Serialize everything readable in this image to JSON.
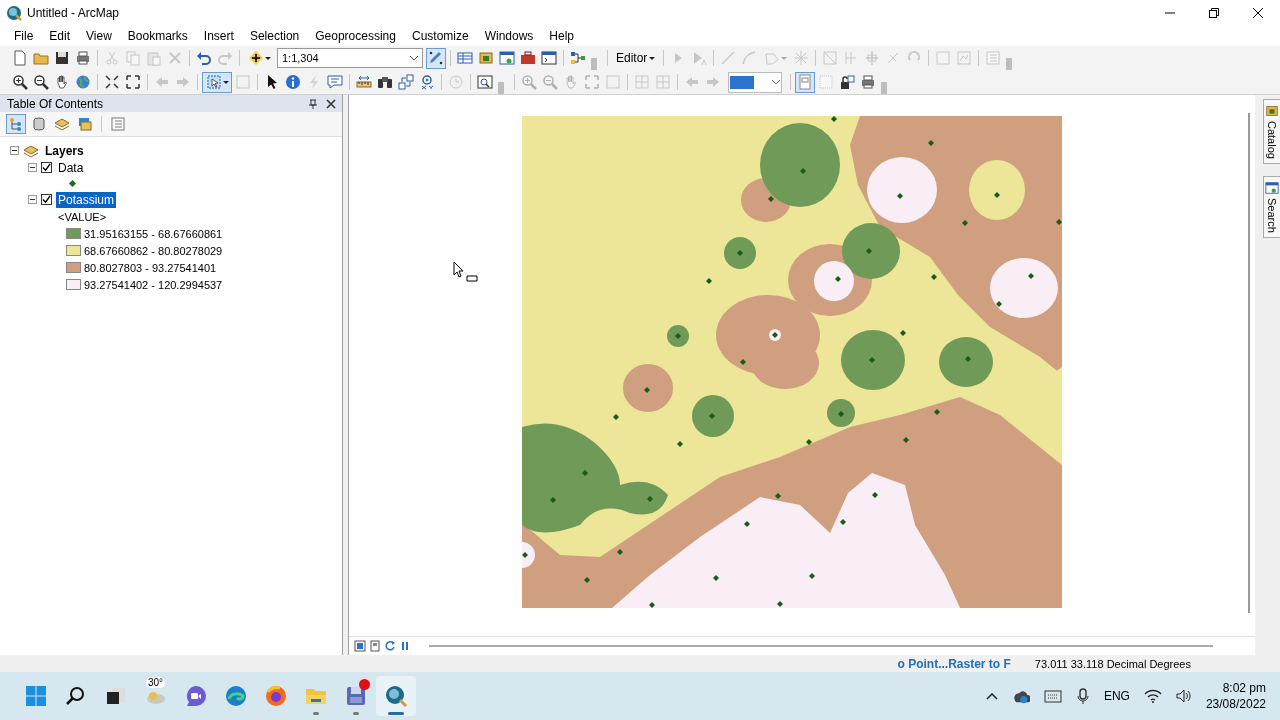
{
  "window": {
    "title": "Untitled - ArcMap"
  },
  "menu": [
    "File",
    "Edit",
    "View",
    "Bookmarks",
    "Insert",
    "Selection",
    "Geoprocessing",
    "Customize",
    "Windows",
    "Help"
  ],
  "toolbars": [
    [
      {
        "kind": "tool",
        "disabled": false
      },
      {
        "kind": "tool",
        "disabled": false
      },
      {
        "kind": "tool",
        "disabled": false
      },
      {
        "kind": "tool",
        "disabled": false
      },
      {
        "kind": "separator"
      },
      {
        "kind": "tool",
        "disabled": true
      },
      {
        "kind": "tool",
        "disabled": true
      },
      {
        "kind": "tool",
        "disabled": true
      },
      {
        "kind": "tool",
        "disabled": true
      },
      {
        "kind": "separator"
      },
      {
        "kind": "tool",
        "disabled": false
      },
      {
        "kind": "tool",
        "disabled": true
      },
      {
        "kind": "separator"
      },
      {
        "kind": "tool",
        "disabled": false,
        "caret": true
      },
      {
        "kind": "scale",
        "value": "1:1,304"
      },
      {
        "kind": "tool",
        "disabled": false,
        "selected": true
      },
      {
        "kind": "separator"
      },
      {
        "kind": "tool",
        "disabled": false
      },
      {
        "kind": "tool",
        "disabled": false
      },
      {
        "kind": "tool",
        "disabled": false
      },
      {
        "kind": "tool",
        "disabled": false
      },
      {
        "kind": "tool",
        "disabled": false
      },
      {
        "kind": "separator"
      },
      {
        "kind": "tool",
        "disabled": false
      },
      {
        "kind": "grip"
      },
      {
        "kind": "separator"
      },
      {
        "kind": "menu",
        "label": "Editor"
      },
      {
        "kind": "separator"
      },
      {
        "kind": "tool",
        "disabled": true
      },
      {
        "kind": "tool",
        "disabled": true
      },
      {
        "kind": "separator"
      },
      {
        "kind": "tool",
        "disabled": true
      },
      {
        "kind": "tool",
        "disabled": true
      },
      {
        "kind": "tool",
        "disabled": true,
        "caret": true
      },
      {
        "kind": "tool",
        "disabled": true
      },
      {
        "kind": "separator"
      },
      {
        "kind": "tool",
        "disabled": true
      },
      {
        "kind": "tool",
        "disabled": true
      },
      {
        "kind": "tool",
        "disabled": true
      },
      {
        "kind": "tool",
        "disabled": true
      },
      {
        "kind": "tool",
        "disabled": true
      },
      {
        "kind": "separator"
      },
      {
        "kind": "tool",
        "disabled": true
      },
      {
        "kind": "tool",
        "disabled": true
      },
      {
        "kind": "separator"
      },
      {
        "kind": "tool",
        "disabled": true
      },
      {
        "kind": "grip"
      }
    ],
    [
      {
        "kind": "tool",
        "disabled": false
      },
      {
        "kind": "tool",
        "disabled": false
      },
      {
        "kind": "tool",
        "disabled": false
      },
      {
        "kind": "tool",
        "disabled": false
      },
      {
        "kind": "separator"
      },
      {
        "kind": "tool",
        "disabled": false
      },
      {
        "kind": "tool",
        "disabled": false
      },
      {
        "kind": "separator"
      },
      {
        "kind": "tool",
        "disabled": true
      },
      {
        "kind": "tool",
        "disabled": true
      },
      {
        "kind": "separator"
      },
      {
        "kind": "tool",
        "disabled": false,
        "selected": true,
        "caret": true
      },
      {
        "kind": "tool",
        "disabled": true
      },
      {
        "kind": "separator"
      },
      {
        "kind": "tool",
        "disabled": false
      },
      {
        "kind": "tool",
        "disabled": false
      },
      {
        "kind": "tool",
        "disabled": true
      },
      {
        "kind": "tool",
        "disabled": false
      },
      {
        "kind": "separator"
      },
      {
        "kind": "tool",
        "disabled": false
      },
      {
        "kind": "tool",
        "disabled": false
      },
      {
        "kind": "tool",
        "disabled": false
      },
      {
        "kind": "tool",
        "disabled": false
      },
      {
        "kind": "separator"
      },
      {
        "kind": "tool",
        "disabled": true
      },
      {
        "kind": "separator"
      },
      {
        "kind": "tool",
        "disabled": false
      },
      {
        "kind": "grip"
      },
      {
        "kind": "separator"
      },
      {
        "kind": "tool",
        "disabled": true
      },
      {
        "kind": "tool",
        "disabled": true
      },
      {
        "kind": "tool",
        "disabled": true
      },
      {
        "kind": "tool",
        "disabled": true
      },
      {
        "kind": "tool",
        "disabled": true
      },
      {
        "kind": "separator"
      },
      {
        "kind": "tool",
        "disabled": true
      },
      {
        "kind": "tool",
        "disabled": true
      },
      {
        "kind": "separator"
      },
      {
        "kind": "tool",
        "disabled": true
      },
      {
        "kind": "tool",
        "disabled": true
      },
      {
        "kind": "zoom-combo"
      },
      {
        "kind": "separator"
      },
      {
        "kind": "tool",
        "disabled": false,
        "selected": true
      },
      {
        "kind": "tool",
        "disabled": true
      },
      {
        "kind": "tool",
        "disabled": false
      },
      {
        "kind": "tool",
        "disabled": false
      },
      {
        "kind": "grip"
      }
    ]
  ],
  "toc": {
    "title": "Table Of Contents",
    "tools": [
      {
        "selected": true
      },
      {
        "selected": false
      },
      {
        "selected": false
      },
      {
        "selected": false
      },
      {
        "selected": false
      }
    ],
    "tree": [
      {
        "label": "Layers",
        "expanded": true,
        "selected": false,
        "children": [
          {
            "label": "Data",
            "kind": "points",
            "checked": true,
            "expanded": true,
            "selected": false
          },
          {
            "label": "Potassium",
            "kind": "raster",
            "checked": true,
            "expanded": true,
            "selected": true,
            "field": "<VALUE>",
            "classes": [
              {
                "label": "31.95163155 - 68.67660861",
                "color": "#6f9a57"
              },
              {
                "label": "68.67660862 - 80.80278029",
                "color": "#ede598"
              },
              {
                "label": "80.8027803 - 93.27541401",
                "color": "#cf9f80"
              },
              {
                "label": "93.27541402 - 120.2994537",
                "color": "#f9eef5"
              }
            ]
          }
        ]
      }
    ]
  },
  "side_tabs": [
    "Catalog",
    "Search"
  ],
  "status_bar": {
    "progress_text": "o Point...Raster to F",
    "coordinates": "73.011  33.118 Decimal Degrees"
  },
  "taskbar": {
    "weather": "30°",
    "language": "ENG",
    "time": "8:02 pm",
    "date": "23/08/2022",
    "apps": [
      {
        "selected": false,
        "running": false
      },
      {
        "selected": false,
        "running": false
      },
      {
        "selected": false,
        "running": false
      },
      {
        "selected": false,
        "running": false
      },
      {
        "selected": false,
        "running": false
      },
      {
        "selected": false,
        "running": false
      },
      {
        "selected": false,
        "running": false
      },
      {
        "selected": false,
        "running": true
      },
      {
        "selected": false,
        "running": true
      },
      {
        "selected": true,
        "running": true
      }
    ]
  }
}
